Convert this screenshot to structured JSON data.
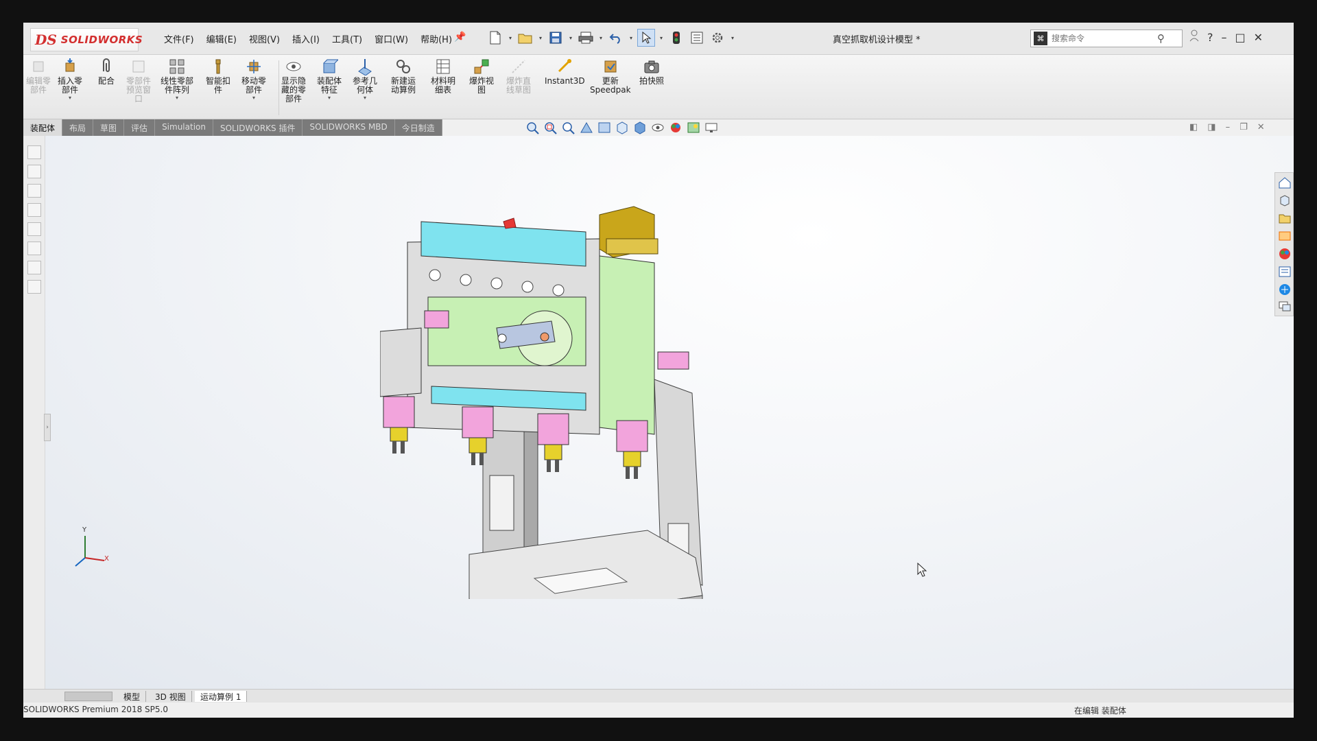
{
  "app": {
    "brand_prefix": "DS",
    "brand": "SOLIDWORKS",
    "doc_title": "真空抓取机设计模型 *",
    "menu": [
      "文件(F)",
      "编辑(E)",
      "视图(V)",
      "插入(I)",
      "工具(T)",
      "窗口(W)",
      "帮助(H)"
    ],
    "search_placeholder": "搜索命令",
    "window_controls": [
      "?",
      "–",
      "□",
      "✕"
    ]
  },
  "ribbon": {
    "buttons": [
      {
        "label": "编辑零\n部件",
        "disabled": true
      },
      {
        "label": "插入零\n部件",
        "disabled": false
      },
      {
        "label": "配合",
        "disabled": false
      },
      {
        "label": "零部件\n预览窗\n口",
        "disabled": true
      },
      {
        "label": "线性零部\n件阵列",
        "disabled": false
      },
      {
        "label": "智能扣\n件",
        "disabled": false
      },
      {
        "label": "移动零\n部件",
        "disabled": false
      },
      {
        "label": "显示隐\n藏的零\n部件",
        "disabled": false
      },
      {
        "label": "装配体\n特征",
        "disabled": false
      },
      {
        "label": "参考几\n何体",
        "disabled": false
      },
      {
        "label": "新建运\n动算例",
        "disabled": false
      },
      {
        "label": "材料明\n细表",
        "disabled": false
      },
      {
        "label": "爆炸视\n图",
        "disabled": false
      },
      {
        "label": "爆炸直\n线草图",
        "disabled": true
      },
      {
        "label": "Instant3D",
        "disabled": false
      },
      {
        "label": "更新\nSpeedpak",
        "disabled": false
      },
      {
        "label": "拍快照",
        "disabled": false
      }
    ]
  },
  "tabs": [
    "装配体",
    "布局",
    "草图",
    "评估",
    "Simulation",
    "SOLIDWORKS 插件",
    "SOLIDWORKS MBD",
    "今日制造"
  ],
  "bottom_tabs": [
    "模型",
    "3D 视图",
    "运动算例 1"
  ],
  "status": {
    "left": "SOLIDWORKS Premium 2018 SP5.0",
    "right": "在编辑 装配体"
  },
  "triad": {
    "x": "X",
    "y": "Y"
  },
  "colors": {
    "accent_red": "#d32f2f",
    "cyan_part": "#7fe3ef",
    "green_part": "#c7f0b4",
    "pink_part": "#f2a4dc",
    "yellow_part": "#e6d12c",
    "olive_motor": "#c9a61b",
    "steel": "#d9d9d9"
  }
}
